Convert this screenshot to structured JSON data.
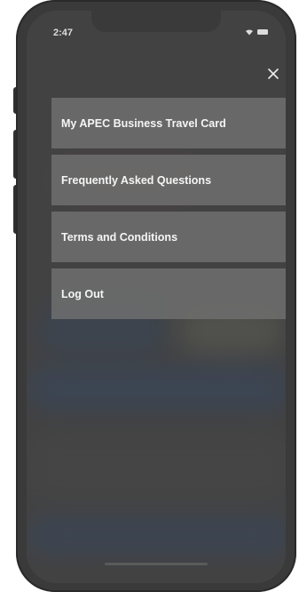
{
  "status_bar": {
    "time": "2:47",
    "wifi_icon": "wifi-icon",
    "battery_icon": "battery-icon"
  },
  "close_button": {
    "icon": "close-icon"
  },
  "menu": {
    "items": [
      {
        "label": "My APEC Business Travel Card"
      },
      {
        "label": "Frequently Asked Questions"
      },
      {
        "label": "Terms and Conditions"
      },
      {
        "label": "Log Out"
      }
    ]
  },
  "colors": {
    "phone_frame": "#3a3a3a",
    "menu_item_bg": "#6e6e6e",
    "menu_text": "#f5f5f5"
  }
}
